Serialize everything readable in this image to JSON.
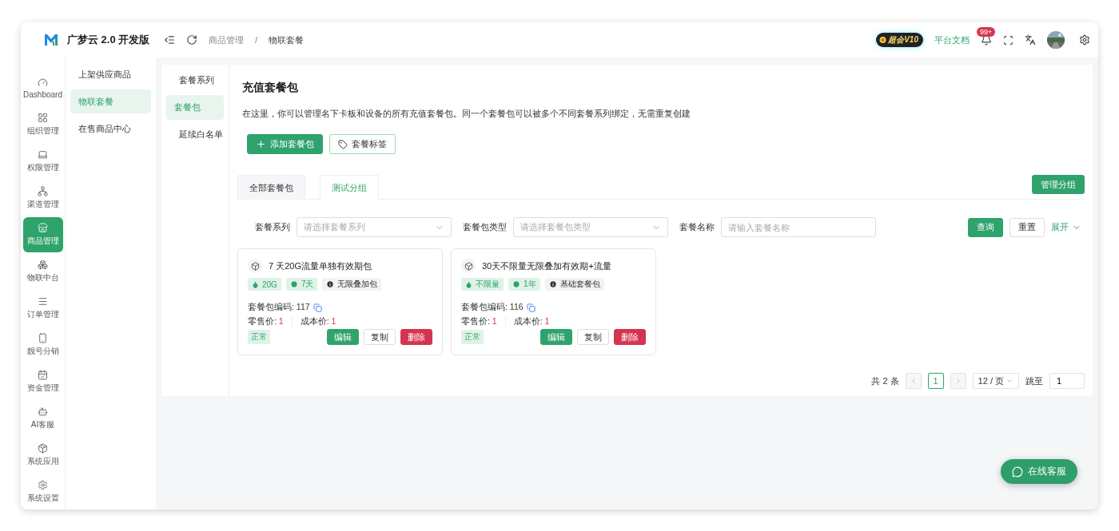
{
  "brand": {
    "name": "广梦云 2.0 开发版"
  },
  "rail": [
    {
      "label": "Dashboard",
      "selected": false
    },
    {
      "label": "组织管理",
      "selected": false
    },
    {
      "label": "权限管理",
      "selected": false
    },
    {
      "label": "渠道管理",
      "selected": false
    },
    {
      "label": "商品管理",
      "selected": true
    },
    {
      "label": "物联中台",
      "selected": false
    },
    {
      "label": "订单管理",
      "selected": false
    },
    {
      "label": "靓号分销",
      "selected": false
    },
    {
      "label": "资金管理",
      "selected": false
    },
    {
      "label": "AI客服",
      "selected": false
    },
    {
      "label": "系统应用",
      "selected": false
    },
    {
      "label": "系统设置",
      "selected": false
    }
  ],
  "submenu": [
    {
      "label": "上架供应商品",
      "selected": false
    },
    {
      "label": "物联套餐",
      "selected": true
    },
    {
      "label": "在售商品中心",
      "selected": false
    }
  ],
  "breadcrumb": {
    "items": [
      "商品管理",
      "物联套餐"
    ],
    "separator": "/"
  },
  "header": {
    "vip_badge": "超会V10",
    "docs_link": "平台文档",
    "notification_count": "99+"
  },
  "side_tabs": [
    {
      "label": "套餐系列",
      "selected": false
    },
    {
      "label": "套餐包",
      "selected": true
    },
    {
      "label": "延续白名单",
      "selected": false
    }
  ],
  "page": {
    "title": "充值套餐包",
    "description": "在这里，你可以管理名下卡板和设备的所有充值套餐包。同一个套餐包可以被多个不同套餐系列绑定，无需重复创建"
  },
  "actions": [
    {
      "label": "添加套餐包",
      "kind": "primary"
    },
    {
      "label": "套餐标签",
      "kind": "outline"
    }
  ],
  "group_tabs": [
    {
      "label": "全部套餐包",
      "selected": false
    },
    {
      "label": "测试分组",
      "selected": true
    }
  ],
  "manage_button": "管理分组",
  "filters": [
    {
      "label": "套餐系列",
      "placeholder": "请选择套餐系列",
      "kind": "select"
    },
    {
      "label": "套餐包类型",
      "placeholder": "请选择套餐包类型",
      "kind": "select"
    },
    {
      "label": "套餐名称",
      "placeholder": "请输入套餐名称",
      "kind": "input"
    }
  ],
  "filter_buttons": {
    "query": "查询",
    "reset": "重置",
    "expand": "展开"
  },
  "packages": [
    {
      "name": "7 天20G流量单独有效期包",
      "tags": [
        {
          "kind": "traffic",
          "text": "20G"
        },
        {
          "kind": "duration",
          "text": "7天"
        },
        {
          "kind": "type",
          "text": "无限叠加包"
        }
      ],
      "code_label": "套餐包编码:",
      "code": "117",
      "retail_label": "零售价:",
      "retail": "1",
      "cost_label": "成本价:",
      "cost": "1",
      "status": "正常",
      "buttons": [
        {
          "label": "编辑",
          "kind": "edit"
        },
        {
          "label": "复制",
          "kind": "copy"
        },
        {
          "label": "删除",
          "kind": "delete"
        }
      ]
    },
    {
      "name": "30天不限量无限叠加有效期+流量",
      "tags": [
        {
          "kind": "traffic",
          "text": "不限量"
        },
        {
          "kind": "duration",
          "text": "1年"
        },
        {
          "kind": "type",
          "text": "基础套餐包"
        }
      ],
      "code_label": "套餐包编码:",
      "code": "116",
      "retail_label": "零售价:",
      "retail": "1",
      "cost_label": "成本价:",
      "cost": "1",
      "status": "正常",
      "buttons": [
        {
          "label": "编辑",
          "kind": "edit"
        },
        {
          "label": "复制",
          "kind": "copy"
        },
        {
          "label": "删除",
          "kind": "delete"
        }
      ]
    }
  ],
  "pagination": {
    "total": "共 2 条",
    "pages": [
      {
        "label": "1",
        "selected": true
      }
    ],
    "page_size": "12 / 页",
    "jump_label": "跳至",
    "jump_value": "1"
  },
  "chat_button": "在线客服"
}
